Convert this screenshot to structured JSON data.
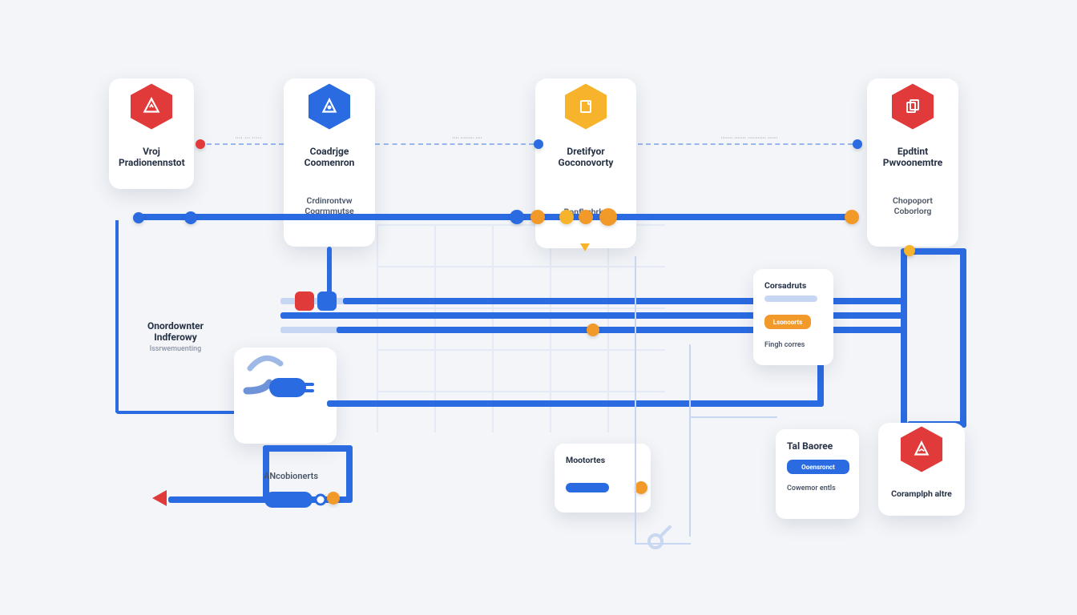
{
  "nodes": {
    "n1": {
      "title_l1": "Vroj",
      "title_l2": "Pradionennstot"
    },
    "n2": {
      "title_l1": "Coadrjge",
      "title_l2": "Coomenron",
      "sub_l1": "Crdinrontvw",
      "sub_l2": "Cogrmmutse"
    },
    "n3": {
      "title_l1": "Dretifyor",
      "title_l2": "Goconovorty",
      "sub": "Bonfhgbrke"
    },
    "n4": {
      "title_l1": "Epdtint",
      "title_l2": "Pwvoonemtre",
      "sub_l1": "Chopoport",
      "sub_l2": "Coborlorg"
    },
    "n5": {
      "label": "Coramplph altre"
    }
  },
  "sidelabels": {
    "left": {
      "l1": "Onordownter",
      "l2": "Indferowy",
      "sub": "lssrwemuenting"
    },
    "bottom": "ANcobionerts"
  },
  "panels": {
    "p1": {
      "title": "Corsadruts",
      "btn": "Lsonoorts",
      "foot": "Fingh corres"
    },
    "p2": {
      "title": "Tal Baoree",
      "btn": "Ooensronct",
      "foot": "Cowemor entls"
    },
    "p3": {
      "title": "Mootortes"
    }
  },
  "colors": {
    "blue": "#2a6be1",
    "orange": "#f19a2a",
    "red": "#e13a3a",
    "yellow": "#f6b32b"
  }
}
